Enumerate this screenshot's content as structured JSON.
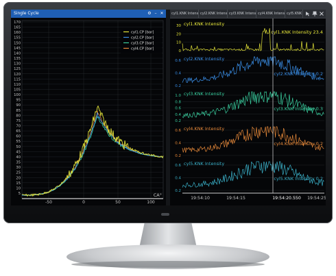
{
  "left_pane": {
    "title": "Single Cycle",
    "buttons": [
      "⚙",
      "–",
      "✕"
    ],
    "plot": {
      "y_ticks": [
        "170",
        "165",
        "160",
        "155",
        "150",
        "145",
        "140",
        "135",
        "130",
        "125",
        "120",
        "115",
        "110",
        "105",
        "100",
        "95",
        "90",
        "85",
        "80",
        "75",
        "70",
        "65",
        "60",
        "55",
        "50",
        "45",
        "40",
        "35",
        "30",
        "25",
        "20",
        "15",
        "10",
        "5"
      ],
      "x_ticks": [
        "-50",
        "0",
        "50",
        "100"
      ],
      "x_unit": "CA°",
      "legend": [
        "cyl1.CP [bar]",
        "cyl2.CP [bar]",
        "cyl3.CP [bar]",
        "cyl4.CP [bar]"
      ],
      "series_colors": [
        "#e8e83a",
        "#3a8fe8",
        "#3ad0a0",
        "#e88a3a"
      ]
    }
  },
  "right_pane": {
    "tabs": [
      "cyl1.KNK Intensity",
      "cyl2.KNK Intensity",
      "cyl3.KNK Intensity",
      "cyl4.KNK Intensity",
      "cyl5.KNK ..."
    ],
    "tab_icons": [
      "cursor-icon",
      "pin-icon",
      "close-icon"
    ],
    "strips": [
      {
        "name": "cyl1.KNK Intensity",
        "color": "#e8e83a",
        "y_ticks": [
          "30",
          "20",
          "10",
          "0"
        ],
        "cursor_label": "cyl1.KNK Intensity 23.4"
      },
      {
        "name": "cyl2.KNK Intensity",
        "color": "#3a8fe8",
        "y_ticks": [
          "0.6",
          "0.4",
          "0.2"
        ],
        "cursor_label": "cyl2.KNK Intensity 0.2"
      },
      {
        "name": "cyl3.KNK Intensity",
        "color": "#3ad0a0",
        "y_ticks": [
          "1.0",
          "0.8",
          "0.6",
          "0.4",
          "0.2"
        ],
        "cursor_label": "cyl3.KNK Intensity 0.3"
      },
      {
        "name": "cyl4.KNK Intensity",
        "color": "#e88a3a",
        "y_ticks": [
          "0.6",
          "0.4",
          "0.2"
        ],
        "cursor_label": "cyl4.KNK Intensity 0.2"
      },
      {
        "name": "cyl5.KNK Intensity",
        "color": "#3ab0c8",
        "y_ticks": [
          "0.6",
          "0.4",
          "0.2"
        ],
        "cursor_label": "cyl5.KNK Intensity 0.2"
      }
    ],
    "x_ticks": [
      "19:54:10",
      "19:54:15",
      "19:54:20.550",
      "19:54:25"
    ]
  },
  "colors": {
    "titlebar": "#1f5fb4",
    "plot_bg": "#050608",
    "grid": "#2a2d33",
    "axis_text": "#c8c8c8",
    "cursor": "#e0e0e0"
  }
}
